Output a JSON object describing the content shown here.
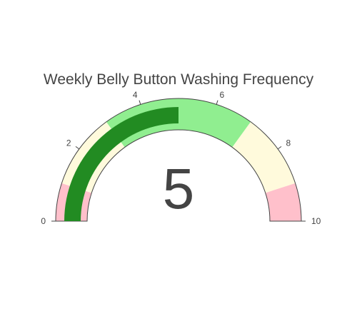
{
  "chart_data": {
    "type": "gauge",
    "title": "Weekly Belly Button Washing Frequency",
    "value": 5,
    "value_label": "5",
    "range": [
      0,
      10
    ],
    "ticks": [
      {
        "value": 0,
        "label": "0"
      },
      {
        "value": 2,
        "label": "2"
      },
      {
        "value": 4,
        "label": "4"
      },
      {
        "value": 6,
        "label": "6"
      },
      {
        "value": 8,
        "label": "8"
      },
      {
        "value": 10,
        "label": "10"
      }
    ],
    "bands": [
      {
        "from": 0,
        "to": 1,
        "color": "#ffc0cb"
      },
      {
        "from": 1,
        "to": 3,
        "color": "#fffadc"
      },
      {
        "from": 3,
        "to": 7,
        "color": "#90ee90"
      },
      {
        "from": 7,
        "to": 9,
        "color": "#fffadc"
      },
      {
        "from": 9,
        "to": 10,
        "color": "#ffc0cb"
      }
    ],
    "bar_color": "#228b22",
    "text_color": "#444444",
    "border_color": "#444444"
  }
}
